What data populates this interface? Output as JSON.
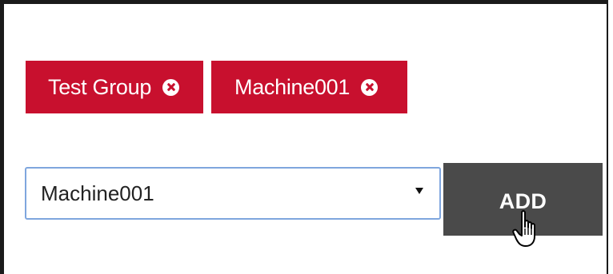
{
  "tags": [
    {
      "label": "Test Group",
      "remove_icon": "circle-x-icon"
    },
    {
      "label": "Machine001",
      "remove_icon": "circle-x-icon"
    }
  ],
  "select": {
    "value": "Machine001",
    "arrow_icon": "caret-down-icon"
  },
  "add_button": {
    "label": "ADD"
  },
  "colors": {
    "tag_background": "#c8102e",
    "button_background": "#4a4a4a",
    "select_border": "#7fa6de"
  },
  "cursor_icon": "hand-pointer-icon"
}
